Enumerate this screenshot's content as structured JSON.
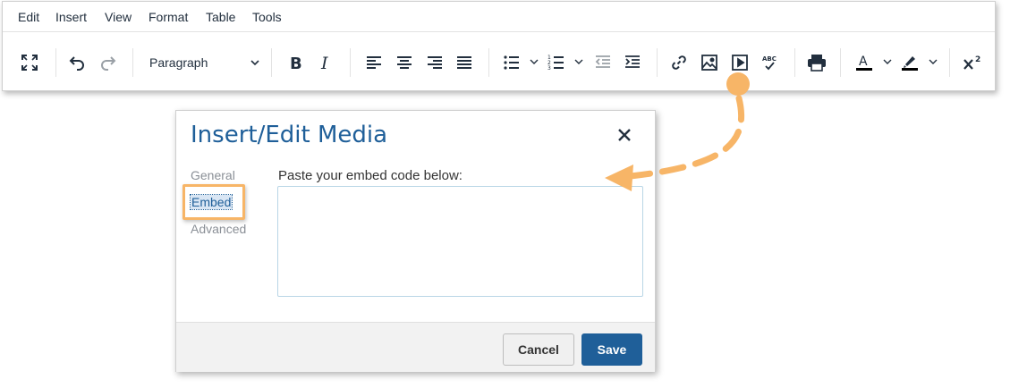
{
  "menubar": {
    "items": [
      "Edit",
      "Insert",
      "View",
      "Format",
      "Table",
      "Tools"
    ]
  },
  "toolbar": {
    "block_format": "Paragraph",
    "buttons": [
      "fullscreen-icon",
      "undo-icon",
      "redo-icon",
      "bold-icon",
      "italic-icon",
      "align-left-icon",
      "align-center-icon",
      "align-right-icon",
      "align-justify-icon",
      "bullet-list-icon",
      "numbered-list-icon",
      "outdent-icon",
      "indent-icon",
      "link-icon",
      "image-icon",
      "media-icon",
      "spellcheck-icon",
      "print-icon",
      "text-color-icon",
      "highlight-color-icon",
      "superscript-icon"
    ],
    "spellcheck_glyph": "ABC",
    "text_color": "#000000",
    "highlight_color": "#000000"
  },
  "dialog": {
    "title": "Insert/Edit Media",
    "tabs": [
      "General",
      "Embed",
      "Advanced"
    ],
    "active_tab": "Embed",
    "embed_label": "Paste your embed code below:",
    "embed_value": "",
    "cancel_label": "Cancel",
    "save_label": "Save"
  },
  "colors": {
    "accent": "#1f5f99",
    "callout": "#f7b567"
  }
}
